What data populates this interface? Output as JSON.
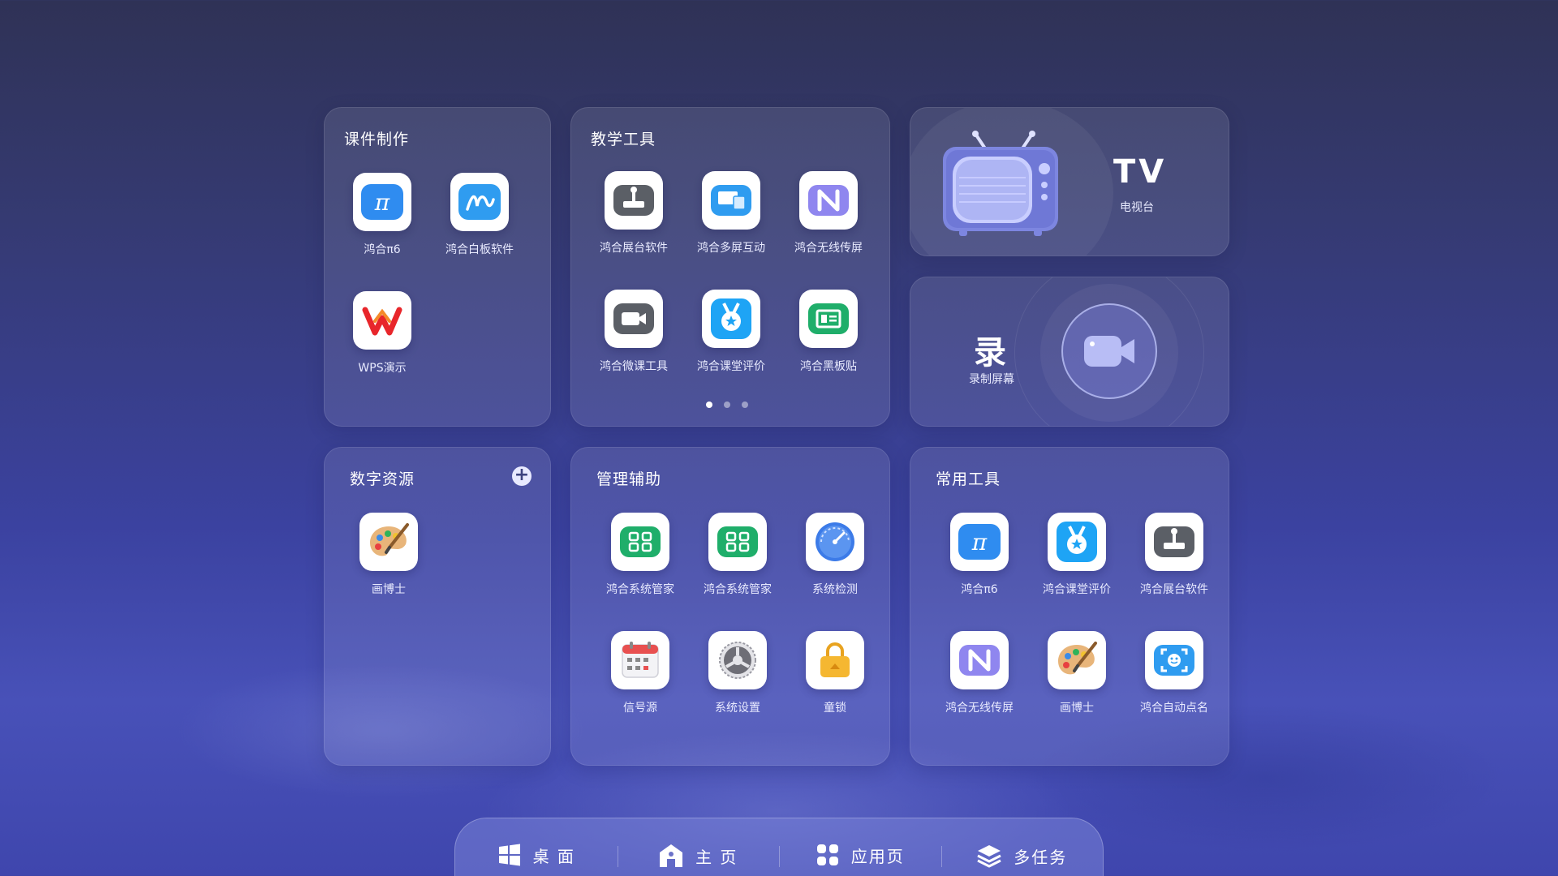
{
  "cards": {
    "courseware": {
      "title": "课件制作",
      "apps": [
        {
          "label": "鸿合π6",
          "icon": "pi-icon"
        },
        {
          "label": "鸿合白板软件",
          "icon": "whiteboard-icon"
        },
        {
          "label": "WPS演示",
          "icon": "wps-icon"
        }
      ]
    },
    "teaching": {
      "title": "教学工具",
      "apps": [
        {
          "label": "鸿合展台软件",
          "icon": "document-camera-icon"
        },
        {
          "label": "鸿合多屏互动",
          "icon": "multiscreen-icon"
        },
        {
          "label": "鸿合无线传屏",
          "icon": "wireless-cast-icon"
        },
        {
          "label": "鸿合微课工具",
          "icon": "video-camera-icon"
        },
        {
          "label": "鸿合课堂评价",
          "icon": "medal-icon"
        },
        {
          "label": "鸿合黑板贴",
          "icon": "blackboard-icon"
        }
      ],
      "page_dots": 3,
      "active_page": 1
    },
    "tv": {
      "title": "TV",
      "subtitle": "电视台"
    },
    "record": {
      "title": "录",
      "subtitle": "录制屏幕"
    },
    "digital": {
      "title": "数字资源",
      "add_label": "+",
      "apps": [
        {
          "label": "画博士",
          "icon": "palette-icon"
        }
      ]
    },
    "manage": {
      "title": "管理辅助",
      "apps": [
        {
          "label": "鸿合系统管家",
          "icon": "system-manager-icon"
        },
        {
          "label": "鸿合系统管家",
          "icon": "system-manager-icon"
        },
        {
          "label": "系统检测",
          "icon": "gauge-icon"
        },
        {
          "label": "信号源",
          "icon": "calendar-icon"
        },
        {
          "label": "系统设置",
          "icon": "settings-icon"
        },
        {
          "label": "童锁",
          "icon": "lock-icon"
        }
      ]
    },
    "common": {
      "title": "常用工具",
      "apps": [
        {
          "label": "鸿合π6",
          "icon": "pi-icon"
        },
        {
          "label": "鸿合课堂评价",
          "icon": "medal-icon"
        },
        {
          "label": "鸿合展台软件",
          "icon": "document-camera-icon"
        },
        {
          "label": "鸿合无线传屏",
          "icon": "wireless-cast-icon"
        },
        {
          "label": "画博士",
          "icon": "palette-icon"
        },
        {
          "label": "鸿合自动点名",
          "icon": "face-scan-icon"
        }
      ]
    }
  },
  "taskbar": {
    "items": [
      {
        "label": "桌 面",
        "icon": "windows-icon"
      },
      {
        "label": "主 页",
        "icon": "home-icon"
      },
      {
        "label": "应用页",
        "icon": "apps-grid-icon"
      },
      {
        "label": "多任务",
        "icon": "layers-icon"
      }
    ]
  },
  "colors": {
    "background_top": "#2f3256",
    "background_bottom": "#3f46ad",
    "accent_blue": "#2f8cf0",
    "accent_green": "#1fae6a"
  }
}
